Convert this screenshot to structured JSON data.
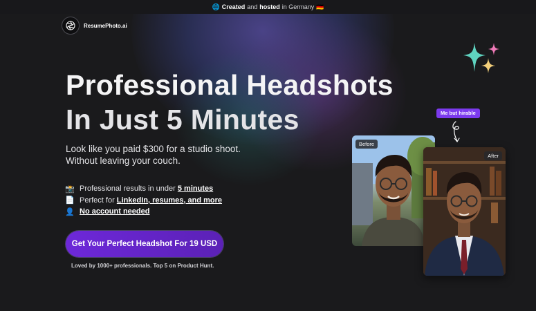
{
  "topbar": {
    "globe": "🌐",
    "created": "Created",
    "and": "and",
    "hosted": "hosted",
    "in_germany": "in Germany",
    "flag": "🇩🇪"
  },
  "brand": {
    "name": "ResumePhoto.ai",
    "logo_icon": "aperture-icon"
  },
  "hero": {
    "title_line1": "Professional Headshots",
    "title_line2": "In Just 5 Minutes",
    "subtitle_line1": "Look like you paid $300 for a studio shoot.",
    "subtitle_line2": "Without leaving your couch."
  },
  "features": [
    {
      "emoji": "📸",
      "text": "Professional results in under ",
      "emph": "5 minutes"
    },
    {
      "emoji": "📄",
      "text": "Perfect for ",
      "emph": "LinkedIn, resumes, and more"
    },
    {
      "emoji": "👤",
      "text": "",
      "emph": "No account needed"
    }
  ],
  "cta": {
    "label": "Get Your Perfect Headshot For 19 USD"
  },
  "social_proof": "Loved by 1000+ professionals. Top 5 on Product Hunt.",
  "showcase": {
    "tag": "Me but hirable",
    "before_label": "Before",
    "after_label": "After"
  },
  "colors": {
    "accent": "#6d28d9",
    "background": "#1a1a1c",
    "tag": "#7c3aed"
  }
}
